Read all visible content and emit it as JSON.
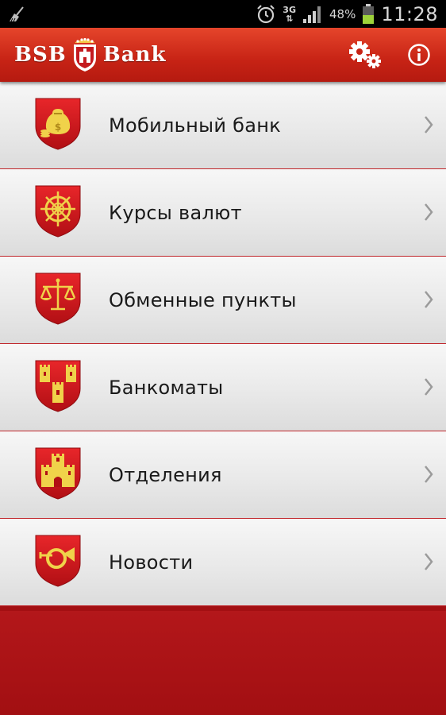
{
  "status_bar": {
    "battery_percent": "48%",
    "network": "3G",
    "time": "11:28",
    "icons": [
      "broom-icon",
      "alarm-icon",
      "network-3g-icon",
      "signal-icon",
      "battery-icon"
    ]
  },
  "header": {
    "logo_left": "BSB",
    "logo_right": "Bank",
    "settings_icon": "gears-icon",
    "info_icon": "info-icon"
  },
  "menu": {
    "items": [
      {
        "label": "Мобильный банк",
        "icon": "money-bag-shield-icon"
      },
      {
        "label": "Курсы валют",
        "icon": "compass-wheel-shield-icon"
      },
      {
        "label": "Обменные пункты",
        "icon": "scales-shield-icon"
      },
      {
        "label": "Банкоматы",
        "icon": "towers-shield-icon"
      },
      {
        "label": "Отделения",
        "icon": "castle-shield-icon"
      },
      {
        "label": "Новости",
        "icon": "post-horn-shield-icon"
      }
    ]
  },
  "colors": {
    "brand_red": "#c72315",
    "background_red": "#a30f12",
    "emblem_gold": "#f0d24a",
    "item_background": "#ebebeb",
    "divider": "#c0262b"
  }
}
